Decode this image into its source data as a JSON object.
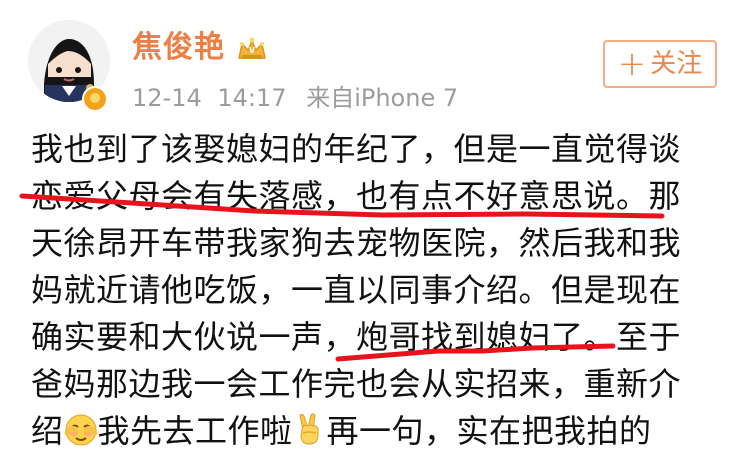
{
  "post": {
    "author": {
      "name": "焦俊艳",
      "avatar_icon": "avatar-icon",
      "verified_icon": "verified-badge-icon",
      "vip_icon": "vip-badge-icon"
    },
    "meta": {
      "date": "12-14",
      "time": "14:17",
      "source": "来自iPhone 7"
    },
    "follow_button": {
      "plus": "+",
      "label": "关注"
    },
    "content": {
      "lines": [
        "我也到了该娶媳妇的年纪了，但是一直觉得谈",
        "恋爱父母会有失落感，也有点不好意思说。那",
        "天徐昂开车带我家狗去宠物医院，然后我和我",
        "妈就近请他吃饭，一直以同事介绍。但是现在",
        "确实要和大伙说一声，炮哥找到媳妇了。至于",
        "爸妈那边我一会工作完也会从实招来，重新介",
        [
          "绍",
          "我先去工作啦",
          "再一句，实在把我拍的"
        ]
      ],
      "emojis": [
        "embarrassed-face-icon",
        "victory-hand-icon"
      ]
    },
    "annotations": {
      "color": "#e8141d"
    }
  }
}
